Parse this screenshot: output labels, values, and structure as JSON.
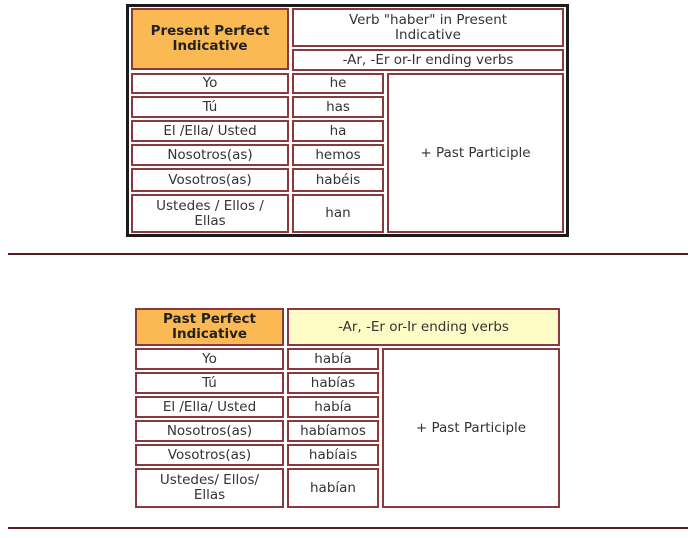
{
  "present_perfect": {
    "title": "Present Perfect Indicative",
    "header_top": "Verb \"haber\" in Present Indicative",
    "header_sub": "-Ar, -Er or-Ir ending verbs",
    "participle": "+ Past Participle",
    "rows": [
      {
        "pronoun": "Yo",
        "verb": "he"
      },
      {
        "pronoun": "Tú",
        "verb": "has"
      },
      {
        "pronoun": "El /Ella/ Usted",
        "verb": "ha"
      },
      {
        "pronoun": "Nosotros(as)",
        "verb": "hemos"
      },
      {
        "pronoun": "Vosotros(as)",
        "verb": "habéis"
      },
      {
        "pronoun": "Ustedes / Ellos / Ellas",
        "verb": "han"
      }
    ]
  },
  "past_perfect": {
    "title": "Past Perfect Indicative",
    "header_sub": "-Ar, -Er or-Ir ending verbs",
    "participle": "+ Past Participle",
    "rows": [
      {
        "pronoun": "Yo",
        "verb": "había"
      },
      {
        "pronoun": "Tú",
        "verb": "habías"
      },
      {
        "pronoun": "El /Ella/ Usted",
        "verb": "había"
      },
      {
        "pronoun": "Nosotros(as)",
        "verb": "habíamos"
      },
      {
        "pronoun": "Vosotros(as)",
        "verb": "habíais"
      },
      {
        "pronoun": "Ustedes/ Ellos/ Ellas",
        "verb": "habían"
      }
    ]
  },
  "colors": {
    "header_orange": "#fbb954",
    "header_pale_yellow": "#fdfcc6",
    "cell_border": "#8a3a3e",
    "divider": "#5a1a1e"
  }
}
